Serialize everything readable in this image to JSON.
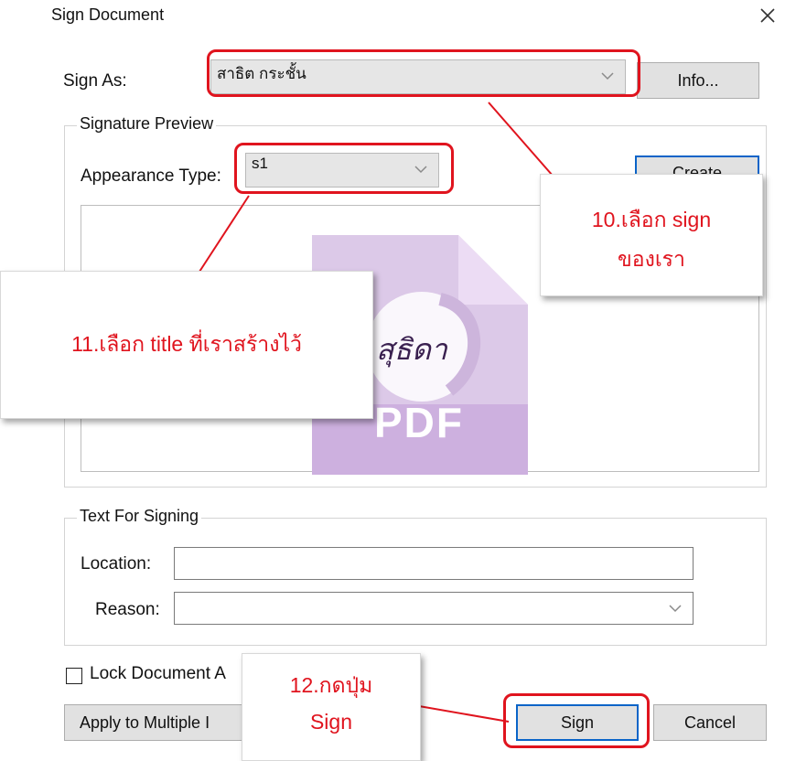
{
  "dialog": {
    "title": "Sign Document",
    "close_icon": "close-icon"
  },
  "sign_as": {
    "label": "Sign As:",
    "selected": "สาธิต กระชั้น",
    "info_button": "Info..."
  },
  "signature_preview": {
    "group_title": "Signature Preview",
    "appearance_label": "Appearance Type:",
    "appearance_selected": "s1",
    "create_button": "Create",
    "preview_text": "PDF",
    "preview_signature": "สุธิดา"
  },
  "text_for_signing": {
    "group_title": "Text For Signing",
    "location_label": "Location:",
    "location_value": "",
    "reason_label": "Reason:",
    "reason_value": ""
  },
  "footer": {
    "lock_label": "Lock Document A",
    "lock_checked": false,
    "apply_button": "Apply to Multiple I",
    "sign_button": "Sign",
    "cancel_button": "Cancel"
  },
  "annotations": {
    "step10_line1": "10.เลือก sign",
    "step10_line2": "ของเรา",
    "step11": "11.เลือก title ที่เราสร้างไว้",
    "step12_line1": "12.กดปุ่ม",
    "step12_line2": "Sign",
    "highlight_color": "#e0141e"
  }
}
